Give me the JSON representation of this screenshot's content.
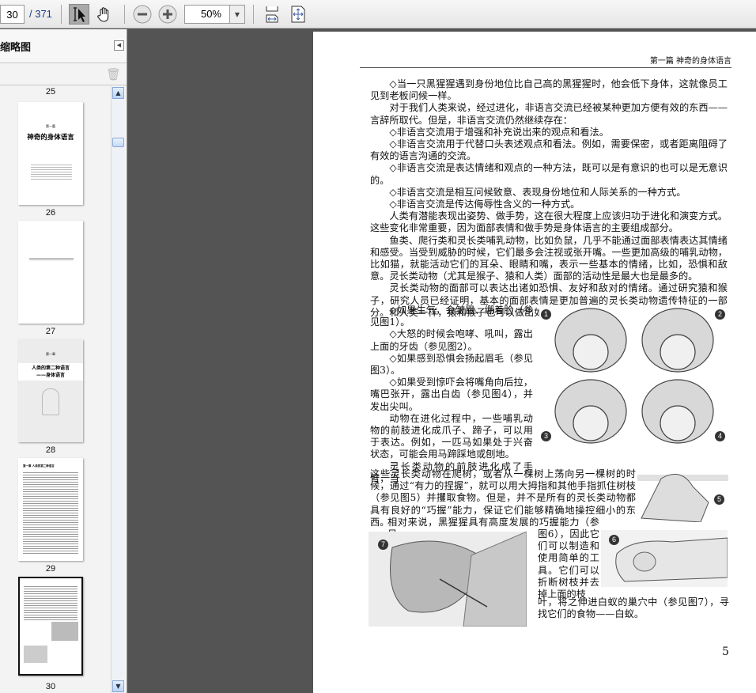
{
  "toolbar": {
    "page_value": "30",
    "page_total": "/ 371",
    "zoom_value": "50%"
  },
  "sidebar": {
    "title": "缩略图",
    "thumbnails": [
      {
        "label": "25"
      },
      {
        "label": "26",
        "title": "神奇的身体语言",
        "kicker": "第一篇"
      },
      {
        "label": "27"
      },
      {
        "label": "28",
        "kicker": "第一章",
        "title": "人类的第二种语言",
        "subtitle": "——身体语言"
      },
      {
        "label": "29",
        "title": "第一章 人类的第二种语言"
      },
      {
        "label": "30"
      }
    ]
  },
  "page": {
    "running_head": "第一篇 神奇的身体语言",
    "block_a": [
      "◇当一只黑猩猩遇到身份地位比自己高的黑猩猩时，他会低下身体，这就像员工见到老板问候一样。",
      "对于我们人类来说，经过进化，非语言交流已经被某种更加方便有效的东西——言辞所取代。但是，非语言交流仍然继续存在：",
      "◇非语言交流用于增强和补充说出来的观点和看法。",
      "◇非语言交流用于代替口头表述观点和看法。例如，需要保密，或者距离阻碍了有效的语言沟通的交流。",
      "◇非语言交流是表达情绪和观点的一种方法，既可以是有意识的也可以是无意识的。",
      "◇非语言交流是相互问候致意、表现身份地位和人际关系的一种方式。",
      "◇非语言交流是传达侮辱性含义的一种方式。",
      "人类有潜能表现出姿势、做手势，这在很大程度上应该归功于进化和演变方式。这些变化非常重要，因为面部表情和做手势是身体语言的主要组成部分。",
      "鱼类、爬行类和灵长类哺乳动物，比如负鼠，几乎不能通过面部表情表达其情绪和感受。当受到威胁的时候，它们最多会注视或张开嘴。一些更加高级的哺乳动物，比如猫，就能活动它们的耳朵、眼睛和嘴，表示一些基本的情绪，比如，恐惧和敌意。灵长类动物（尤其是猴子、猿和人类）面部的活动性是最大也是最多的。",
      "灵长类动物的面部可以表达出诸如恐惧、友好和敌对的情绪。通过研究猿和猴子，研究人员已经证明，基本的面部表情是更加普遍的灵长类动物遗传特征的一部分。和人类一样，猿和猴子也可以做出如下表现："
    ],
    "block_b": [
      "◇如果生气，会皱眉、绷着脸（参见图1）。",
      "◇大怒的时候会咆哮、吼叫，露出上面的牙齿（参见图2）。",
      "◇如果感到恐惧会扬起眉毛（参见图3）。",
      "◇如果受到惊吓会将嘴角向后拉，嘴巴张开，露出白齿（参见图4），并发出尖叫。",
      "动物在进化过程中，一些哺乳动物的前肢进化成爪子、蹄子，可以用于表达。例如，一匹马如果处于兴奋状态，可能会用马蹄踩地或刨地。",
      "灵长类动物的前肢进化成了手臂，当"
    ],
    "block_c": "这些灵长类动物在爬树，或者从一棵树上荡向另一棵树的时候，通过“有力的捏握”，就可以用大拇指和其他手指抓住树枝（参见图5）并攫取食物。但是，并不是所有的灵长类动物都具有良好的“巧握”能力，保证它们能够精确地操控细小的东西。",
    "block_d": "相对来说，黑猩猩具有高度发展的巧握能力（参见",
    "block_e": "图6），因此它们可以制造和使用简单的工具。它们可以折断树枝并去掉上面的枝",
    "block_f": "叶，将之伸进白蚁的巢穴中（参见图7），寻找它们的食物——白蚁。",
    "figures": [
      "1",
      "2",
      "3",
      "4",
      "5",
      "6",
      "7"
    ],
    "page_number": "5"
  }
}
